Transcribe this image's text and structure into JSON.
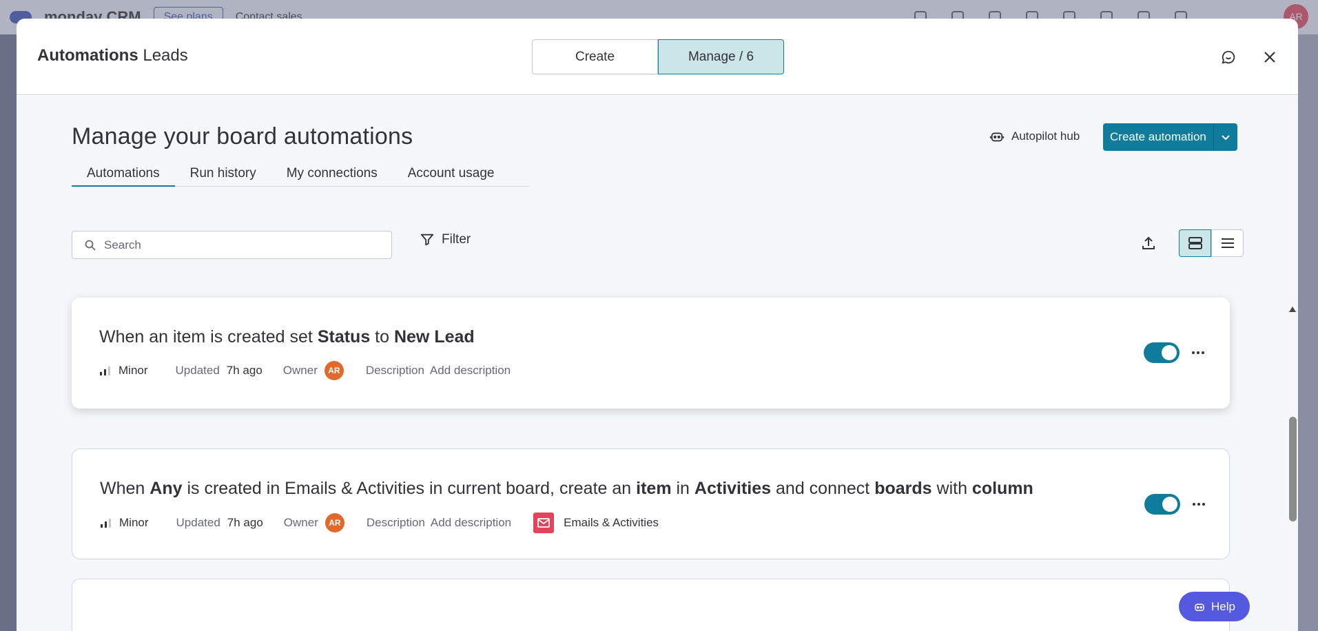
{
  "background": {
    "brand": "monday CRM",
    "see_plans": "See plans",
    "contact_sales": "Contact sales",
    "avatar": "AR"
  },
  "header": {
    "title_strong": "Automations",
    "title_board": "Leads",
    "seg_create": "Create",
    "seg_manage": "Manage / 6"
  },
  "page": {
    "heading": "Manage your board automations",
    "autopilot": "Autopilot hub",
    "create_automation": "Create automation"
  },
  "tabs": [
    "Automations",
    "Run history",
    "My connections",
    "Account usage"
  ],
  "search": {
    "placeholder": "Search"
  },
  "filter": {
    "label": "Filter"
  },
  "cards": [
    {
      "title_parts": [
        {
          "t": "When an item is created set ",
          "b": false
        },
        {
          "t": "Status",
          "b": true
        },
        {
          "t": " to ",
          "b": false
        },
        {
          "t": "New Lead",
          "b": true
        }
      ],
      "level": "Minor",
      "updated_label": "Updated",
      "updated": "7h ago",
      "owner_label": "Owner",
      "owner": "AR",
      "description_label": "Description",
      "add_description": "Add description",
      "enabled": true
    },
    {
      "title_parts": [
        {
          "t": "When ",
          "b": false
        },
        {
          "t": "Any",
          "b": true
        },
        {
          "t": " is created in Emails & Activities in current board, create an ",
          "b": false
        },
        {
          "t": "item",
          "b": true
        },
        {
          "t": " in ",
          "b": false
        },
        {
          "t": "Activities",
          "b": true
        },
        {
          "t": " and connect ",
          "b": false
        },
        {
          "t": "boards",
          "b": true
        },
        {
          "t": " with ",
          "b": false
        },
        {
          "t": "column",
          "b": true
        }
      ],
      "level": "Minor",
      "updated_label": "Updated",
      "updated": "7h ago",
      "owner_label": "Owner",
      "owner": "AR",
      "description_label": "Description",
      "add_description": "Add description",
      "app": "Emails & Activities",
      "enabled": true
    }
  ],
  "help": {
    "label": "Help"
  },
  "colors": {
    "accent": "#0f7c9c",
    "accent_light": "#cce5e8",
    "help": "#5559df",
    "owner_avatar": "#e2692c",
    "email_app": "#e2445c"
  }
}
